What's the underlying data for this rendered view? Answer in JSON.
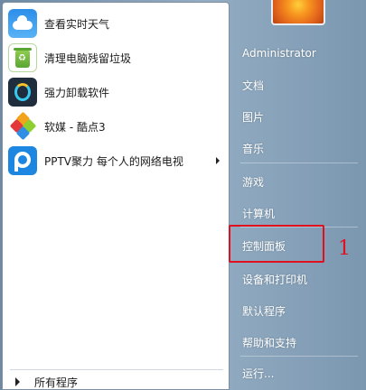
{
  "programs": [
    {
      "label": "查看实时天气",
      "icon": "weather-icon",
      "has_submenu": false
    },
    {
      "label": "清理电脑残留垃圾",
      "icon": "recycle-bin-icon",
      "has_submenu": false
    },
    {
      "label": "强力卸载软件",
      "icon": "uninstall-icon",
      "has_submenu": false
    },
    {
      "label": "软媒 - 酷点3",
      "icon": "cubes-icon",
      "has_submenu": false
    },
    {
      "label": "PPTV聚力 每个人的网络电视",
      "icon": "pptv-icon",
      "has_submenu": true
    }
  ],
  "all_programs_label": "所有程序",
  "right_items": {
    "user": "Administrator",
    "documents": "文档",
    "pictures": "图片",
    "music": "音乐",
    "games": "游戏",
    "computer": "计算机",
    "control_panel": "控制面板",
    "devices_printers": "设备和打印机",
    "default_programs": "默认程序",
    "help_support": "帮助和支持",
    "run": "运行..."
  },
  "annotation": {
    "number": "1",
    "color": "#e0101e"
  },
  "colors": {
    "right_pane": "#8aa5bd",
    "left_pane": "#ffffff",
    "highlight": "#e0101e"
  }
}
